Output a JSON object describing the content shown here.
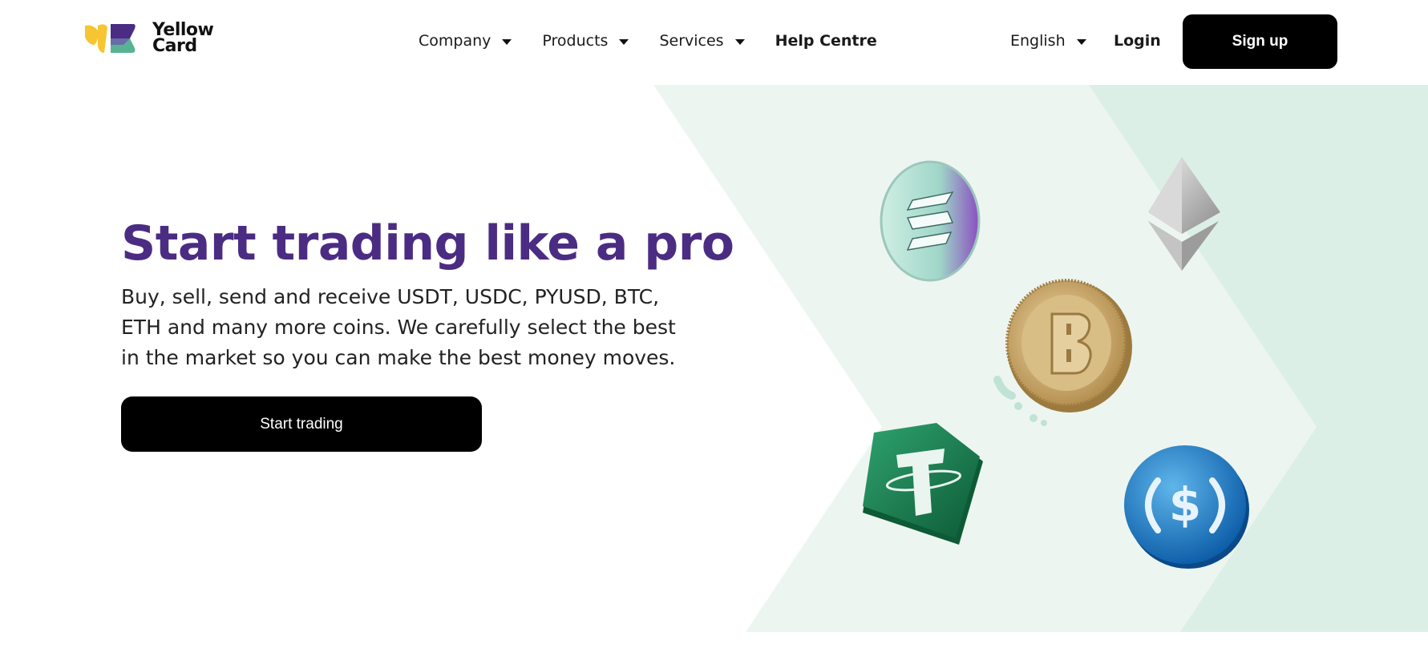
{
  "header": {
    "logo_text": [
      "Yellow",
      "Card"
    ],
    "nav": [
      {
        "label": "Company",
        "has_dropdown": true
      },
      {
        "label": "Products",
        "has_dropdown": true
      },
      {
        "label": "Services",
        "has_dropdown": true
      },
      {
        "label": "Help Centre",
        "has_dropdown": false
      }
    ],
    "language": "English",
    "login_label": "Login",
    "signup_label": "Sign up"
  },
  "hero": {
    "title": "Start trading like a pro",
    "description": "Buy, sell, send and receive USDT, USDC, PYUSD, BTC, ETH and many more coins. We carefully select the best in the market so you can make the best money moves.",
    "cta_label": "Start trading"
  },
  "colors": {
    "brand_purple": "#4b2c83",
    "brand_yellow": "#f6c531",
    "brand_green": "#58b394",
    "hero_bg_light": "#edf5f1",
    "hero_bg_mid": "#dcefe7",
    "button_black": "#000000"
  },
  "illustration": {
    "coins": [
      "solana-coin",
      "ethereum-coin",
      "bitcoin-coin",
      "tether-coin",
      "usdc-coin"
    ]
  }
}
